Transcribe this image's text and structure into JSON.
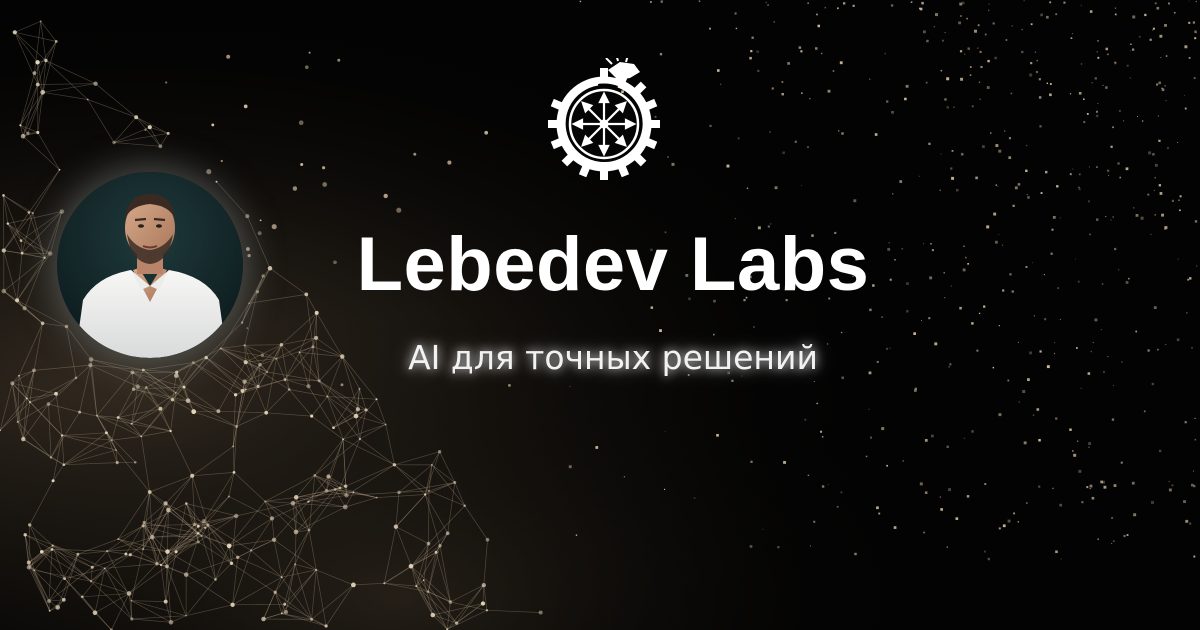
{
  "brand": {
    "title": "Lebedev Labs",
    "tagline": "AI для точных решений"
  },
  "visuals": {
    "background_color": "#030303",
    "particle_color": "#d9c3a4",
    "network_color": "#b9a58a",
    "logo_color": "#ffffff",
    "logo_icon": "gear-ouroboros-arrows-icon",
    "avatar_icon": "portrait-photo"
  }
}
